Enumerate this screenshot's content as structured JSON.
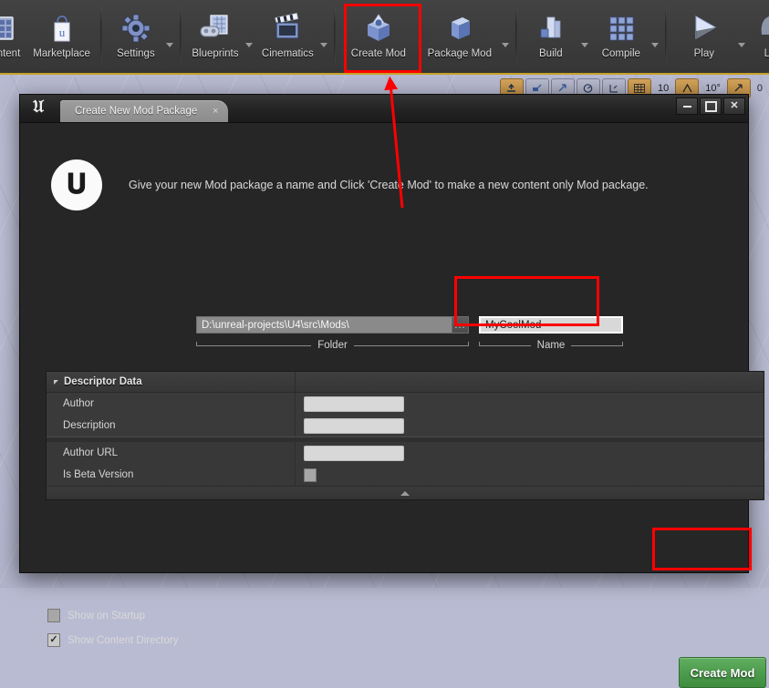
{
  "toolbar": {
    "items": [
      {
        "label": "Content",
        "icon": "content-browser-icon",
        "caret": false,
        "truncated": true
      },
      {
        "label": "Marketplace",
        "icon": "marketplace-bag-icon",
        "caret": false
      },
      {
        "label": "Settings",
        "icon": "settings-gear-icon",
        "caret": true
      },
      {
        "label": "Blueprints",
        "icon": "blueprints-icon",
        "caret": true
      },
      {
        "label": "Cinematics",
        "icon": "cinematics-clapperboard-icon",
        "caret": true
      },
      {
        "label": "Create Mod",
        "icon": "create-mod-box-icon",
        "caret": false,
        "highlighted": true
      },
      {
        "label": "Package Mod",
        "icon": "package-mod-box-icon",
        "caret": true
      },
      {
        "label": "Build",
        "icon": "build-icon",
        "caret": true
      },
      {
        "label": "Compile",
        "icon": "compile-cubes-icon",
        "caret": true
      },
      {
        "label": "Play",
        "icon": "play-triangle-icon",
        "caret": true
      },
      {
        "label": "L",
        "icon": "launch-icon",
        "caret": false,
        "truncated": true
      }
    ]
  },
  "snapbar": {
    "grid_snap_value": "10",
    "angle_snap_value": "10°",
    "scale_snap_value": "0",
    "cells": [
      {
        "icon": "surface-snap-icon",
        "active": true
      },
      {
        "icon": "translate-snap-icon",
        "active": false
      },
      {
        "icon": "move-snap-icon",
        "active": false
      },
      {
        "icon": "camera-speed-icon",
        "active": false
      },
      {
        "icon": "scale-grid-icon",
        "active": false
      },
      {
        "icon": "grid-snap-icon",
        "active": true
      },
      {
        "icon": "angle-snap-icon",
        "active": true
      },
      {
        "icon": "scale-snap-icon",
        "active": true
      }
    ]
  },
  "dialog": {
    "tab_label": "Create New Mod Package",
    "tab_close_glyph": "×",
    "window_controls": {
      "minimize": "minimize-button",
      "maximize": "maximize-button",
      "close": "✕"
    },
    "logo_glyph": "𝔘",
    "intro_text": "Give your new Mod package a name and Click 'Create Mod' to make a new content only Mod package.",
    "folder": {
      "value": "D:\\unreal-projects\\U4\\src\\Mods\\",
      "caption": "Folder",
      "browse_label": "..."
    },
    "name": {
      "value": "MyCoolMod",
      "caption": "Name"
    },
    "descriptor": {
      "title": "Descriptor Data",
      "groups": [
        {
          "rows": [
            {
              "label": "Author",
              "type": "text",
              "value": ""
            },
            {
              "label": "Description",
              "type": "text",
              "value": ""
            }
          ]
        },
        {
          "rows": [
            {
              "label": "Author URL",
              "type": "text",
              "value": ""
            },
            {
              "label": "Is Beta Version",
              "type": "checkbox",
              "checked": false
            }
          ]
        }
      ]
    },
    "options": [
      {
        "label": "Show on Startup",
        "checked": false
      },
      {
        "label": "Show Content Directory",
        "checked": true
      }
    ],
    "primary_button": "Create Mod"
  },
  "annotations": {
    "accent_color": "#ff0000",
    "boxes": [
      "create-mod-toolbar-button",
      "name-input-field",
      "create-mod-submit-button"
    ],
    "arrow": "points-from-dialog-to-create-mod-toolbar-button"
  }
}
